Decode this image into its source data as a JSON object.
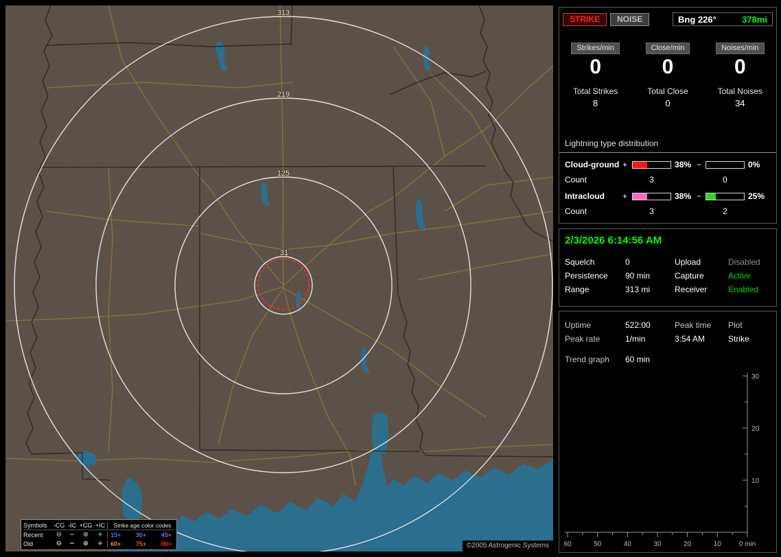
{
  "colors": {
    "accent_green": "#00ff00",
    "alert_red": "#ff2020",
    "map_background": "#5c5149",
    "water_blue": "#2b6e8e",
    "road_yellow": "#8f7e34",
    "range_ring_white": "#e2e2e2"
  },
  "map": {
    "range_ring_labels": [
      "313",
      "219",
      "125",
      "31"
    ],
    "legend": {
      "col_headers": [
        "Symbols",
        "-CG",
        "-IC",
        "+CG",
        "+IC"
      ],
      "age_title": "Strike age color codes",
      "symbols": [
        "⊖",
        "−",
        "⊕",
        "+"
      ],
      "rows": [
        {
          "label": "Recent",
          "symbol_color": "#3fcf8f",
          "ages": [
            {
              "label": "15+",
              "color": "#5566ff"
            },
            {
              "label": "30+",
              "color": "#7d5af2"
            },
            {
              "label": "45+",
              "color": "#a055e6"
            }
          ]
        },
        {
          "label": "Old",
          "symbol_color": "#d8d04e",
          "ages": [
            {
              "label": "60+",
              "color": "#f08a1e"
            },
            {
              "label": "75+",
              "color": "#f05a16"
            },
            {
              "label": "90+",
              "color": "#f02814"
            }
          ]
        }
      ]
    },
    "copyright": "©2005 Astrogenic Systems"
  },
  "sidebar": {
    "toolbar": {
      "strike_button": "STRIKE",
      "noise_button": "NOISE",
      "bearing_label": "Bng 226°",
      "bearing_range": "378mi",
      "bearing_range_color": "#00ff00"
    },
    "rates": [
      {
        "header": "Strikes/min",
        "value": "0",
        "total_label": "Total Strikes",
        "total_value": "8"
      },
      {
        "header": "Close/min",
        "value": "0",
        "total_label": "Total Close",
        "total_value": "0"
      },
      {
        "header": "Noises/min",
        "value": "0",
        "total_label": "Total Noises",
        "total_value": "34"
      }
    ],
    "distribution": {
      "title": "Lightning type distribution",
      "count_label": "Count",
      "plus_sign": "+",
      "minus_sign": "−",
      "rows": [
        {
          "name": "Cloud-ground",
          "plus_pct": "38%",
          "plus_fill": "38%",
          "plus_color": "#ff1414",
          "plus_count": "3",
          "minus_pct": "0%",
          "minus_fill": "0%",
          "minus_color": "#ffffff",
          "minus_count": "0"
        },
        {
          "name": "Intracloud",
          "plus_pct": "38%",
          "plus_fill": "38%",
          "plus_color": "#ff66cc",
          "plus_count": "3",
          "minus_pct": "25%",
          "minus_fill": "25%",
          "minus_color": "#22dd22",
          "minus_count": "2"
        }
      ]
    },
    "status": {
      "datetime": "2/3/2026 6:14:56 AM",
      "datetime_color": "#00ff00",
      "rows": [
        {
          "key1": "Squelch",
          "val1": "0",
          "key2": "Upload",
          "val2": "Disabled",
          "val2_color": "#8f8f8f"
        },
        {
          "key1": "Persistence",
          "val1": "90 min",
          "key2": "Capture",
          "val2": "Active",
          "val2_color": "#00e000"
        },
        {
          "key1": "Range",
          "val1": "313 mi",
          "key2": "Receiver",
          "val2": "Enabled",
          "val2_color": "#00e000"
        }
      ]
    },
    "trend": {
      "uptime_label": "Uptime",
      "uptime_value": "522:00",
      "peak_rate_label": "Peak rate",
      "peak_rate_value": "1/min",
      "peak_time_label": "Peak time",
      "peak_time_value": "3:54 AM",
      "plot_label": "Plot",
      "plot_value": "Strike",
      "trend_graph_label": "Trend graph",
      "trend_graph_value": "60 min",
      "chart": {
        "type": "line",
        "ylim": [
          0,
          30
        ],
        "y_ticks": [
          "30",
          "20",
          "10"
        ],
        "x_ticks": [
          "60",
          "50",
          "40",
          "30",
          "20",
          "10",
          "0 min"
        ],
        "series": [
          {
            "name": "Strike",
            "values": []
          }
        ]
      }
    }
  }
}
